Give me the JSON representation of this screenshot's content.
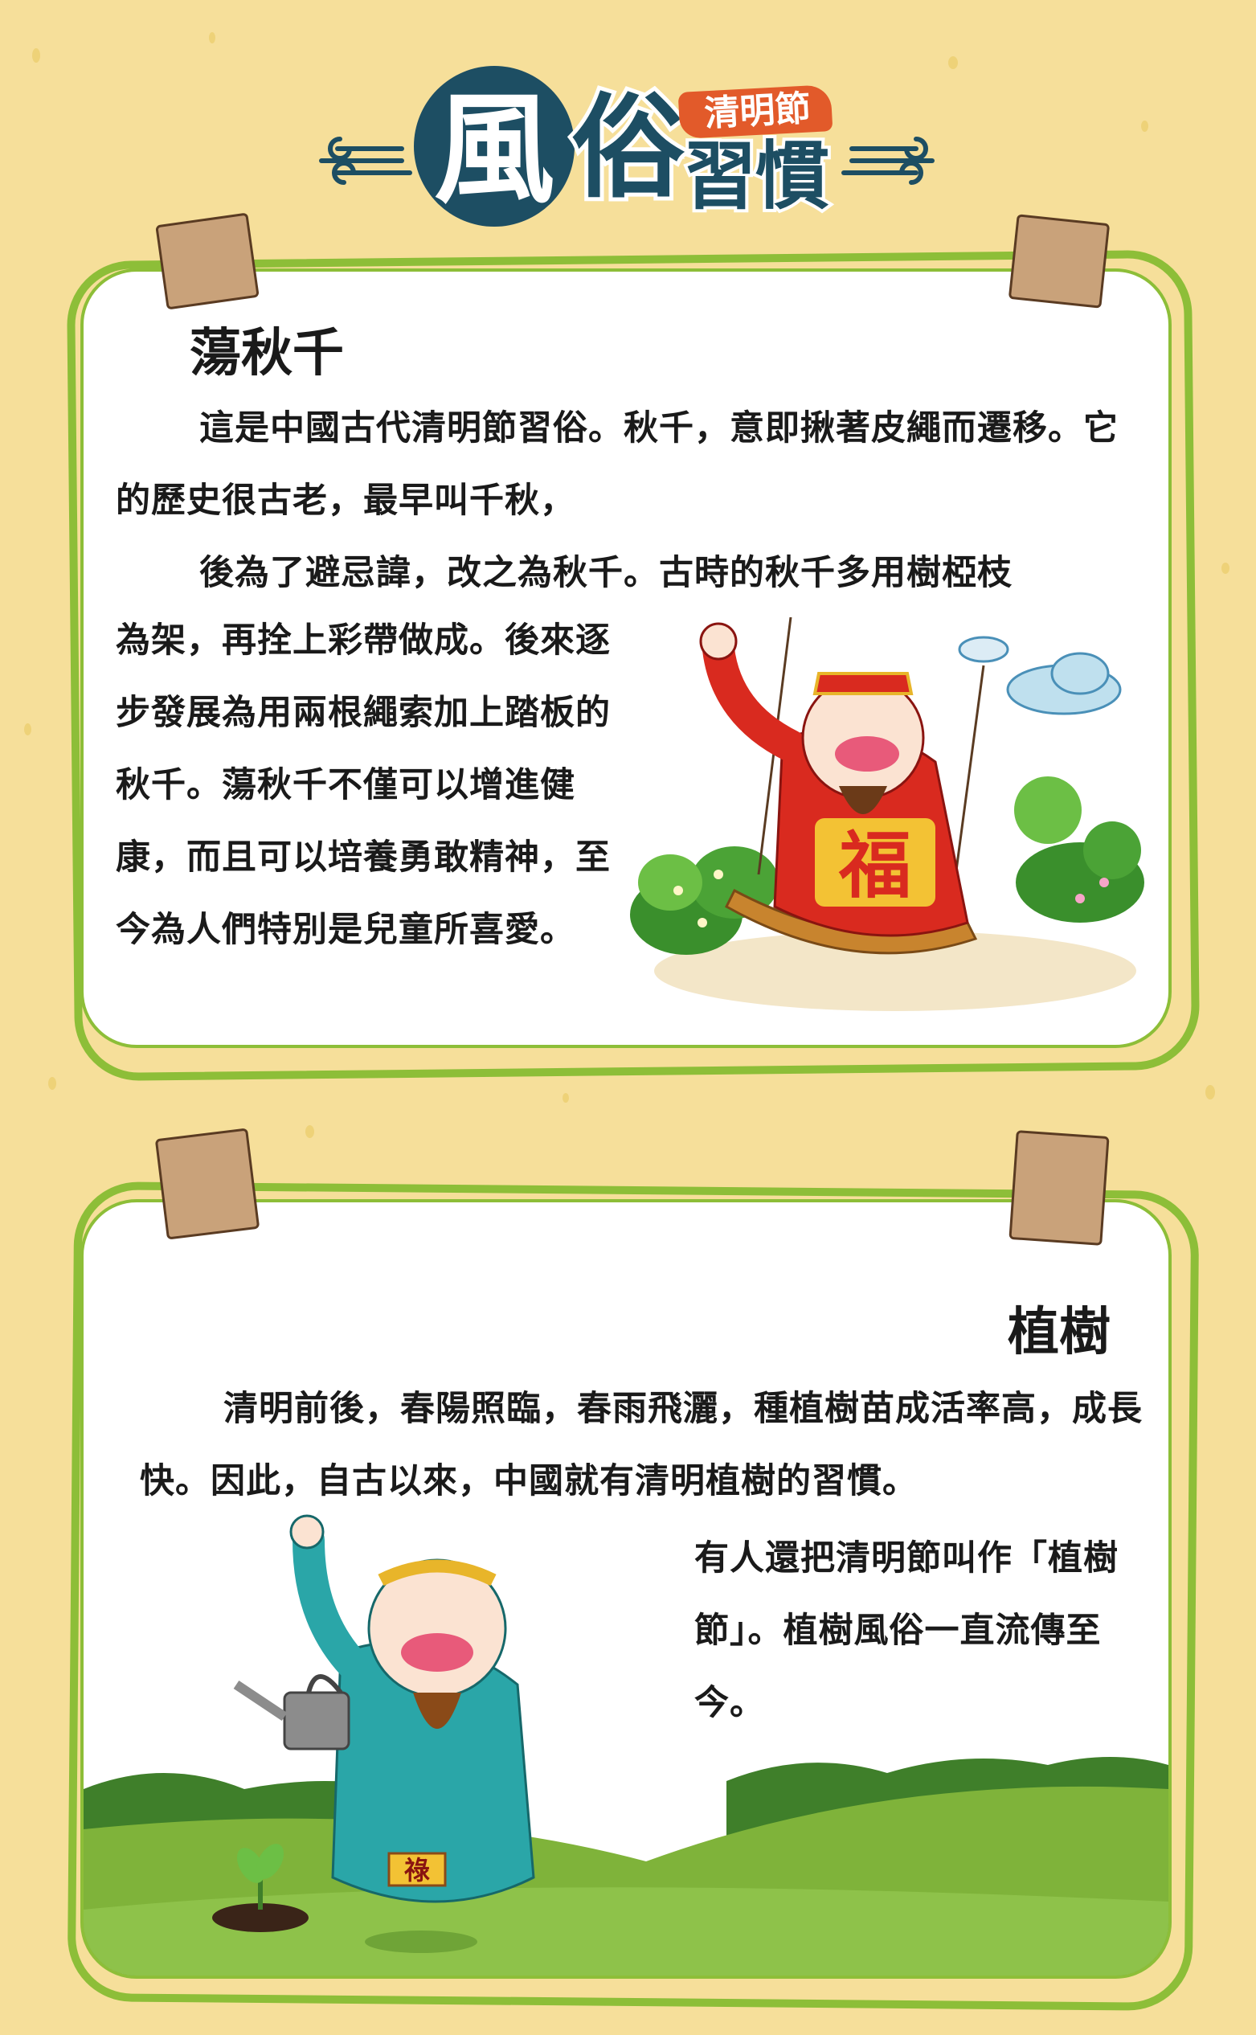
{
  "header": {
    "title_char_1": "風",
    "title_char_2": "俗",
    "title_rest": "習慣",
    "badge": "清明節"
  },
  "swing_card": {
    "title": "蕩秋千",
    "paragraphs": [
      "這是中國古代清明節習俗。秋千，意即揪著皮繩而遷移。它的歷史很古老，最早叫千秋，",
      "後為了避忌諱，改之為秋千。古時的秋千多用樹椏枝",
      "為架，再拴上彩帶做成。後來逐步發展為用兩根繩索加上踏板的秋千。蕩秋千不僅可以增進健康，而且可以培養勇敢精神，至今為人們特別是兒童所喜愛。"
    ],
    "emblem_char": "福"
  },
  "tree_card": {
    "title": "植樹",
    "paragraphs": [
      "清明前後，春陽照臨，春雨飛灑，種植樹苗成活率高，成長快。因此，自古以來，中國就有清明植樹的習慣。",
      "有人還把清明節叫作「植樹節」。植樹風俗一直流傳至今。"
    ],
    "emblem_char": "祿"
  },
  "colors": {
    "background": "#f6df9a",
    "card_border": "#8dbe38",
    "title_blue": "#1d4e63",
    "badge_orange": "#e25a2a",
    "clip_brown": "#c9a27a",
    "robe_red": "#d92a1f",
    "robe_teal": "#2aa6a8",
    "grass": "#7fb33a"
  },
  "icons": [
    "wind-swirl-icon",
    "paper-clip-icon",
    "cloud-icon",
    "bush-icon",
    "tree-icon",
    "watering-can-icon",
    "seedling-icon"
  ]
}
